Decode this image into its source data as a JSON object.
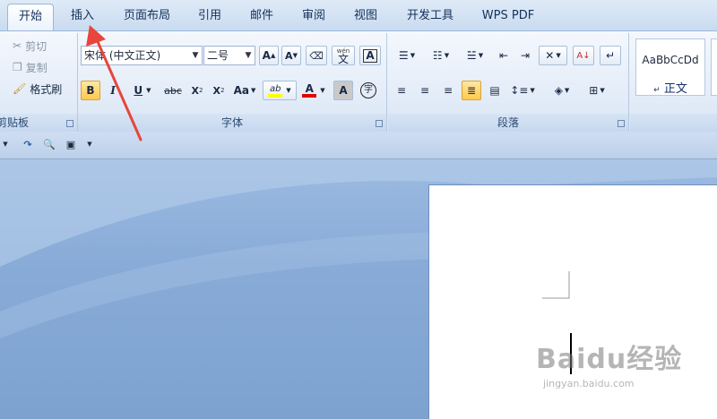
{
  "tabs": [
    "开始",
    "插入",
    "页面布局",
    "引用",
    "邮件",
    "审阅",
    "视图",
    "开发工具",
    "WPS PDF"
  ],
  "active_tab": "开始",
  "clipboard": {
    "label": "剪贴板",
    "cut": "剪切",
    "copy": "复制",
    "format_painter": "格式刷"
  },
  "font": {
    "label": "字体",
    "font_name": "宋体 (中文正文)",
    "font_size": "二号",
    "grow": "A",
    "shrink": "A",
    "pinyin": "wén",
    "pinyin_char": "文",
    "border_a": "A",
    "bold": "B",
    "italic": "I",
    "underline": "U",
    "strike": "abc",
    "subscript": "X",
    "superscript": "X",
    "change_case": "Aa",
    "highlight": "ab",
    "font_color": "A",
    "shading_a": "A",
    "enclose": "字"
  },
  "paragraph": {
    "label": "段落"
  },
  "styles": {
    "sample": "AaBbCcDd",
    "name": "正文"
  },
  "watermark": {
    "brand": "Baidu经验",
    "url": "jingyan.baidu.com"
  },
  "colors": {
    "arrow": "#e8453c",
    "highlight_bar": "#ffff00",
    "font_color_bar": "#e00000"
  }
}
